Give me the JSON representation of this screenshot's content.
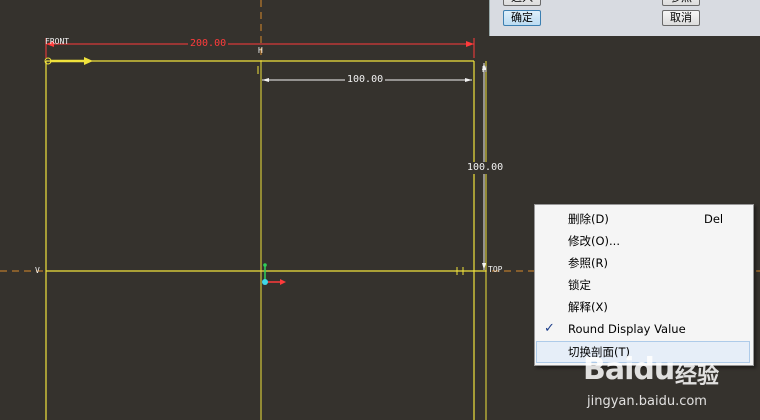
{
  "sketch": {
    "dim_width": "200.00",
    "dim_half_width": "100.00",
    "dim_height": "100.00",
    "label_front": "FRONT",
    "label_h_top": "H",
    "label_h_mid": "H",
    "label_v_left": "V",
    "label_top": "TOP",
    "colors": {
      "background": "#35322d",
      "geometry": "#f0e23c",
      "reference": "#d8892a",
      "dimension_red": "#ff3b3b",
      "dimension": "#f2f2f2"
    }
  },
  "dialog": {
    "buttons": [
      {
        "label": "选入",
        "kind": "normal"
      },
      {
        "label": "参照",
        "kind": "normal"
      },
      {
        "label": "确定",
        "kind": "primary"
      },
      {
        "label": "取消",
        "kind": "normal"
      }
    ]
  },
  "context_menu": {
    "items": [
      {
        "label": "删除(D)",
        "shortcut": "Del",
        "checked": false
      },
      {
        "label": "修改(O)...",
        "shortcut": "",
        "checked": false
      },
      {
        "label": "参照(R)",
        "shortcut": "",
        "checked": false
      },
      {
        "label": "锁定",
        "shortcut": "",
        "checked": false
      },
      {
        "label": "解释(X)",
        "shortcut": "",
        "checked": false
      },
      {
        "label": "Round Display Value",
        "shortcut": "",
        "checked": true
      },
      {
        "label": "切换剖面(T)",
        "shortcut": "",
        "checked": false,
        "highlighted": true
      }
    ],
    "check_mark": "✓"
  },
  "watermark": {
    "logo": "Baidu",
    "product": "经验",
    "url": "jingyan.baidu.com"
  }
}
